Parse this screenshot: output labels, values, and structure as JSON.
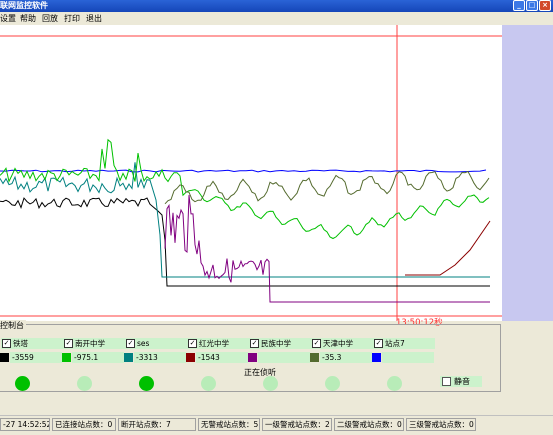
{
  "window": {
    "title": "联网监控软件",
    "controls": [
      "_",
      "□",
      "×"
    ]
  },
  "menu": {
    "items": [
      "设置",
      "帮助",
      "回放",
      "打印",
      "退出"
    ]
  },
  "plot": {
    "time_readout": "13:50:12秒",
    "colors": {
      "background": "#ffffff",
      "reference_lines": "#ff4040",
      "right_panel": "#c8c8f0"
    }
  },
  "chart_data": {
    "type": "line",
    "series": [
      {
        "name": "铁塔",
        "color": "#000000"
      },
      {
        "name": "南开中学",
        "color": "#00c000"
      },
      {
        "name": "ses",
        "color": "#008080"
      },
      {
        "name": "红光中学",
        "color": "#8b0000"
      },
      {
        "name": "民族中学",
        "color": "#800080"
      },
      {
        "name": "天津中学",
        "color": "#556b2f"
      },
      {
        "name": "站点7",
        "color": "#0000ff"
      }
    ]
  },
  "control": {
    "title": "控制台",
    "status_text": "正在侦听",
    "mute_label": "静音",
    "stations": [
      {
        "name": "铁塔",
        "checked": "✓",
        "value": "-3559",
        "color": "#000000",
        "led": "on"
      },
      {
        "name": "南开中学",
        "checked": "✓",
        "value": "-975.1",
        "color": "#00c000",
        "led": "off"
      },
      {
        "name": "ses",
        "checked": "✓",
        "value": "-3313",
        "color": "#008080",
        "led": "on"
      },
      {
        "name": "红光中学",
        "checked": "✓",
        "value": "-1543",
        "color": "#8b0000",
        "led": "off"
      },
      {
        "name": "民族中学",
        "checked": "✓",
        "value": "",
        "color": "#800080",
        "led": "off"
      },
      {
        "name": "天津中学",
        "checked": "✓",
        "value": "-35.3",
        "color": "#556b2f",
        "led": "off"
      },
      {
        "name": "站点7",
        "checked": "✓",
        "value": "",
        "color": "#0000ff",
        "led": "off"
      }
    ],
    "led_colors": {
      "on": "#00c000",
      "off": "#b8ecb8"
    }
  },
  "status": {
    "datetime": "-27 14:52:52",
    "connected": "已连接站点数：0",
    "disconnected": "断开站点数：7",
    "no_alarm": "无警戒站点数：5",
    "level1": "一级警戒站点数：2",
    "level2": "二级警戒站点数：0",
    "level3": "三级警戒站点数：0"
  }
}
